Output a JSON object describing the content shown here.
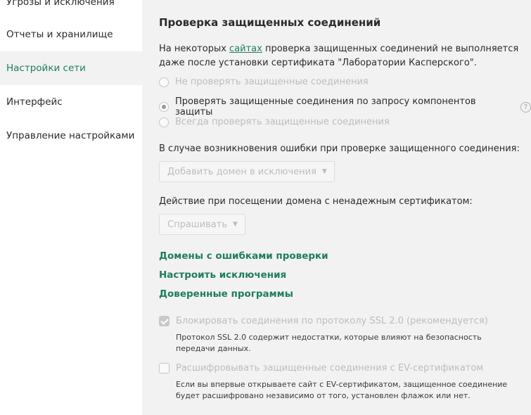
{
  "sidebar": {
    "items": [
      {
        "label": "Угрозы и исключения"
      },
      {
        "label": "Отчеты и хранилище"
      },
      {
        "label": "Настройки сети"
      },
      {
        "label": "Интерфейс"
      },
      {
        "label": "Управление настройками"
      }
    ],
    "active_index": 2
  },
  "main": {
    "title": "Проверка защищенных соединений",
    "desc_before": "На некоторых ",
    "desc_link": "сайтах",
    "desc_after": " проверка защищенных соединений не выполняется даже после установки сертификата \"Лаборатории Касперского\".",
    "radios": [
      {
        "label": "Не проверять защищенные соединения",
        "checked": false,
        "disabled": true
      },
      {
        "label": "Проверять защищенные соединения по запросу компонентов защиты",
        "checked": true,
        "disabled": false
      },
      {
        "label": "Всегда проверять защищенные соединения",
        "checked": false,
        "disabled": true
      }
    ],
    "help_glyph": "?",
    "error_label": "В случае возникновения ошибки при проверке защищенного соединения:",
    "error_select_value": "Добавить домен в исключения",
    "untrusted_label": "Действие при посещении домена с ненадежным сертификатом:",
    "untrusted_select_value": "Спрашивать",
    "links": {
      "domains_errors": "Домены с ошибками проверки",
      "exclusions": "Настроить исключения",
      "trusted_apps": "Доверенные программы"
    },
    "ssl2": {
      "label": "Блокировать соединения по протоколу SSL 2.0 (рекомендуется)",
      "checked": true,
      "note": "Протокол SSL 2.0 содержит недостатки, которые влияют на безопасность передачи данных."
    },
    "ev": {
      "label": "Расшифровывать защищенные соединения с EV-сертификатом",
      "checked": false,
      "note": "Если вы впервые открываете сайт с EV-сертификатом, защищенное соединение будет расшифровано независимо от того, установлен флажок или нет."
    }
  },
  "colors": {
    "accent": "#1e7e5a",
    "panel_bg": "#f2f2f2",
    "disabled_text": "#bdbdbd"
  }
}
